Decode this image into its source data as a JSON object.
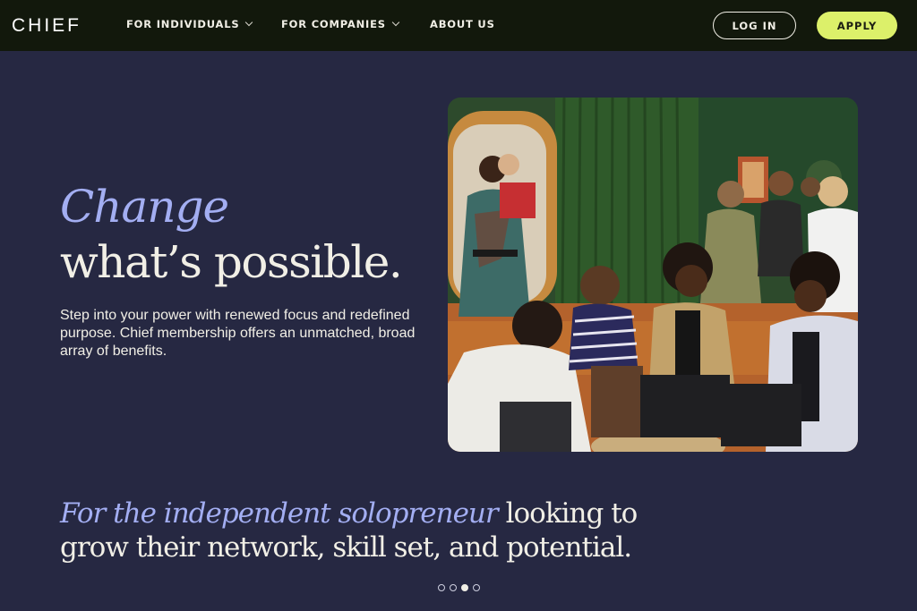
{
  "nav": {
    "logo": "CHIEF",
    "links": [
      {
        "label": "FOR INDIVIDUALS",
        "has_dropdown": true
      },
      {
        "label": "FOR COMPANIES",
        "has_dropdown": true
      },
      {
        "label": "ABOUT US",
        "has_dropdown": false
      }
    ],
    "login_label": "LOG IN",
    "apply_label": "APPLY"
  },
  "hero": {
    "title_accent": "Change",
    "title_main": "what’s possible.",
    "description": "Step into your power with renewed focus and redefined purpose. Chief membership offers an unmatched, broad array of benefits."
  },
  "tagline": {
    "accent": "For the independent solopreneur",
    "rest": " looking to grow their network, skill set, and potential."
  },
  "carousel": {
    "total": 4,
    "active_index": 2
  },
  "colors": {
    "background": "#262842",
    "nav_background": "#12180c",
    "accent_text": "#a3aef2",
    "apply_button": "#dcf06a",
    "text": "#f1efe6"
  },
  "icons": {
    "dropdown": "chevron-down-icon"
  }
}
